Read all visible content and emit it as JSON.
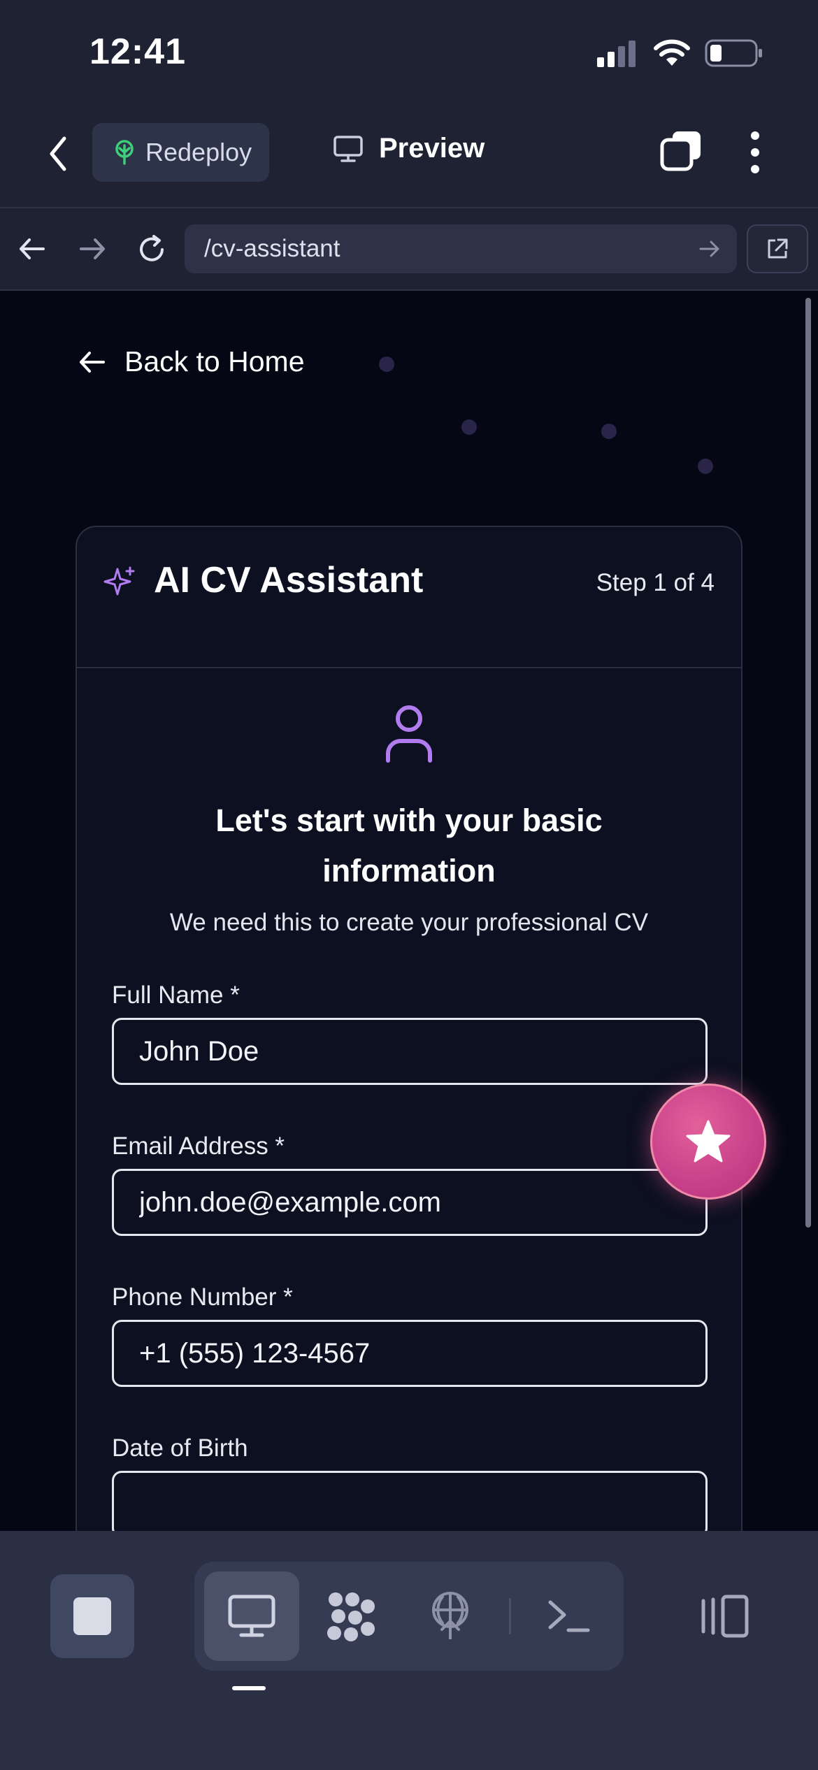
{
  "status_bar": {
    "time": "12:41"
  },
  "app_bar": {
    "redeploy_label": "Redeploy",
    "preview_label": "Preview"
  },
  "browser": {
    "url": "/cv-assistant"
  },
  "page": {
    "back_label": "Back to Home",
    "card": {
      "title": "AI CV Assistant",
      "step": "Step 1 of 4",
      "heading_line1": "Let's start with your basic",
      "heading_line2": "information",
      "subheading": "We need this to create your professional CV",
      "fields": {
        "full_name_label": "Full Name *",
        "full_name_value": "John Doe",
        "email_label": "Email Address *",
        "email_value": "john.doe@example.com",
        "phone_label": "Phone Number *",
        "phone_value": "+1 (555) 123-4567",
        "dob_label": "Date of Birth",
        "dob_value": ""
      }
    }
  },
  "colors": {
    "accent_purple": "#b07cf0",
    "redeploy_green": "#3ecf7a",
    "fab_pink": "#d4508e"
  },
  "icons": {
    "back": "chevron-left-icon",
    "redeploy": "tree-icon",
    "preview": "monitor-icon",
    "tabs": "tabs-icon",
    "more": "more-vertical-icon",
    "assistant": "sparkle-icon",
    "user": "user-icon",
    "fab": "star-icon"
  }
}
